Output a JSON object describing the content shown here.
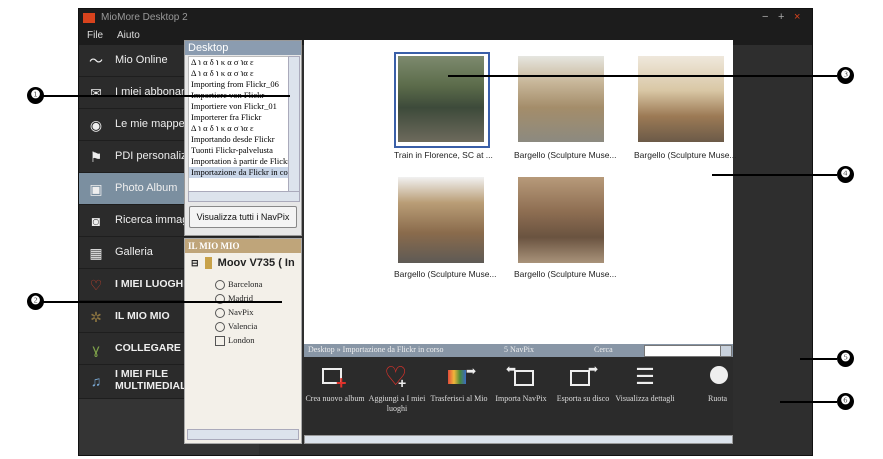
{
  "window": {
    "title": "MioMore Desktop 2",
    "controls": [
      "−",
      "+",
      "×"
    ]
  },
  "menu": [
    "File",
    "Aiuto"
  ],
  "sidebar": [
    {
      "label": "Mio Online",
      "icon": "mio-online-icon",
      "style": "normal"
    },
    {
      "label": "I miei abbonamenti",
      "icon": "envelope-icon",
      "style": "normal"
    },
    {
      "label": "Le mie mappe",
      "icon": "map-pin-icon",
      "style": "normal"
    },
    {
      "label": "PDI personalizzati",
      "icon": "flag-icon",
      "style": "normal"
    },
    {
      "label": "Photo Album",
      "icon": "photo-album-icon",
      "style": "active"
    },
    {
      "label": "Ricerca immagini",
      "icon": "camera-icon",
      "style": "normal"
    },
    {
      "label": "Galleria",
      "icon": "gallery-icon",
      "style": "normal"
    },
    {
      "label": "I MIEI LUOGHI",
      "icon": "heart-icon",
      "style": "bold"
    },
    {
      "label": "IL MIO MIO",
      "icon": "gear-icon",
      "style": "bold"
    },
    {
      "label": "COLLEGARE",
      "icon": "connect-icon",
      "style": "bold"
    },
    {
      "label": "I MIEI FILE MULTIMEDIALI",
      "icon": "music-note-icon",
      "style": "bold"
    }
  ],
  "folder_panel": {
    "title": "Desktop",
    "items": [
      "Δ ℩ α δ ℩ κ α σ ℩α ε",
      "Δ ℩ α δ ℩ κ α σ ℩α ε",
      "Importing from Flickr_06",
      "Importiere von Flickr",
      "Importiere von Flickr_01",
      "Importerer fra Flickr",
      "Δ ℩ α δ ℩ κ α σ ℩α ε",
      "Importando desde Flickr",
      "Tuonti Flickr-palvelusta",
      "Importation à partir de Flickr",
      "Importazione da Flickr in corso"
    ],
    "view_all_button": "Visualizza tutti i NavPix"
  },
  "my_stuff": {
    "title": "IL MIO MIO",
    "device": "Moov V735 ( In",
    "items": [
      "Barcelona",
      "Madrid",
      "NavPix",
      "Valencia",
      "London"
    ]
  },
  "photos": [
    {
      "caption": "Train in Florence, SC at ...",
      "selected": true
    },
    {
      "caption": "Bargello (Sculpture Muse...",
      "selected": false
    },
    {
      "caption": "Bargello (Sculpture Muse...",
      "selected": false
    },
    {
      "caption": "Bargello (Sculpture Muse...",
      "selected": false
    },
    {
      "caption": "Bargello (Sculpture Muse...",
      "selected": false
    }
  ],
  "status": {
    "breadcrumb": "Desktop » Importazione da Flickr in corso",
    "count": "5 NavPix",
    "search_label": "Cerca",
    "search_value": ""
  },
  "actions": [
    {
      "label": "Crea nuovo album",
      "icon": "create-album-icon"
    },
    {
      "label": "Aggiungi a I miei luoghi",
      "icon": "add-to-places-icon"
    },
    {
      "label": "Trasferisci al Mio",
      "icon": "transfer-icon"
    },
    {
      "label": "Importa NavPix",
      "icon": "import-icon"
    },
    {
      "label": "Esporta su disco",
      "icon": "export-icon"
    },
    {
      "label": "Visualizza dettagli",
      "icon": "details-list-icon"
    },
    {
      "label": "Ruota",
      "icon": "rotate-icon"
    }
  ],
  "callouts": [
    "❶",
    "❷",
    "❸",
    "❹",
    "❺",
    "❻"
  ]
}
